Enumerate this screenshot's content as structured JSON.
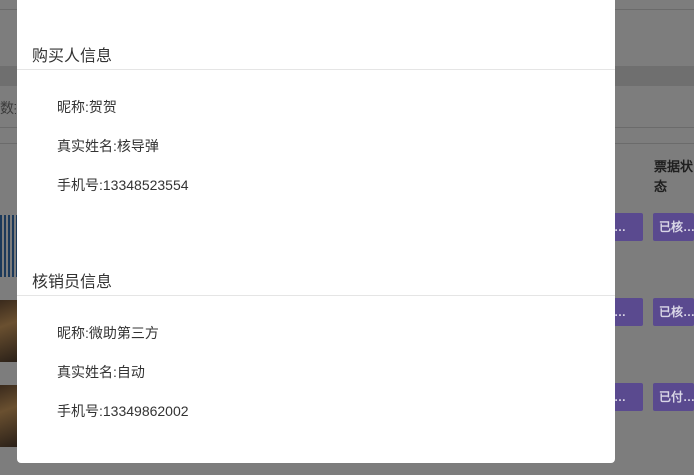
{
  "buyer": {
    "title": "购买人信息",
    "nickname_label": "昵称:",
    "nickname": "贺贺",
    "realname_label": "真实姓名:",
    "realname": "核导弹",
    "phone_label": "手机号:",
    "phone": "13348523554"
  },
  "verifier": {
    "title": "核销员信息",
    "nickname_label": "昵称:",
    "nickname": "微助第三方",
    "realname_label": "真实姓名:",
    "realname": "自动",
    "phone_label": "手机号:",
    "phone": "13349862002"
  },
  "background": {
    "left_partial_text": "数据",
    "column_header": "票据状态",
    "row_buttons_left": [
      "…",
      "…",
      "…"
    ],
    "row_status_buttons": [
      "已核…",
      "已核…",
      "已付…"
    ]
  }
}
